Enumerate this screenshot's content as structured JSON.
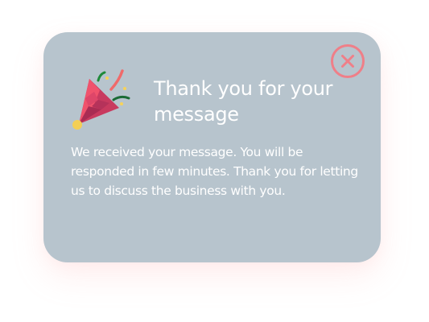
{
  "dialog": {
    "title": "Thank you for your message",
    "message": "We received your message. You will be responded in few minutes. Thank you for letting us to discuss the business with you.",
    "icon": "party-popper-icon",
    "close_icon": "close-icon"
  },
  "colors": {
    "card_background": "#b7c4cd",
    "close_accent": "#ef7f88",
    "text": "#ffffff"
  }
}
